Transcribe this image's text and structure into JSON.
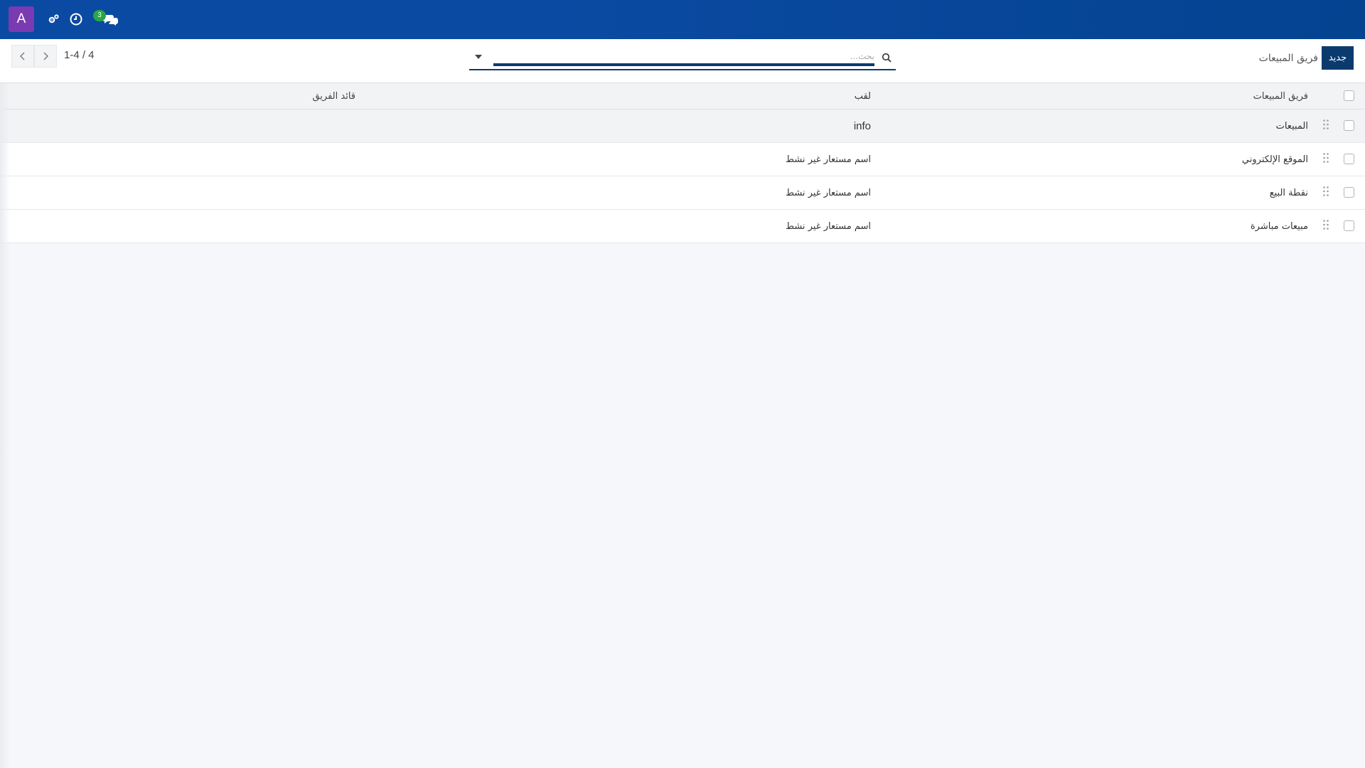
{
  "navbar": {
    "avatar_letter": "A",
    "icons": [
      "settings-cogs-icon",
      "clock-icon",
      "chat-bubbles-icon"
    ],
    "chat_badge": "3",
    "colors": {
      "bar": "#0a4aa2",
      "avatar": "#7a3ab1",
      "badge": "#28a745"
    }
  },
  "control_panel": {
    "new_button": "جديد",
    "title": "فريق المبيعات",
    "search_placeholder": "بحث...",
    "pager": "1-4 / 4"
  },
  "table": {
    "columns": {
      "team": "فريق المبيعات",
      "alias": "لقب",
      "leader": "قائد الفريق"
    },
    "rows": [
      {
        "team": "المبيعات",
        "alias": "info",
        "leader": ""
      },
      {
        "team": "الموقع الإلكتروني",
        "alias": "اسم مستعار غير نشط",
        "leader": ""
      },
      {
        "team": "نقطة البيع",
        "alias": "اسم مستعار غير نشط",
        "leader": ""
      },
      {
        "team": "مبيعات مباشرة",
        "alias": "اسم مستعار غير نشط",
        "leader": ""
      }
    ]
  }
}
